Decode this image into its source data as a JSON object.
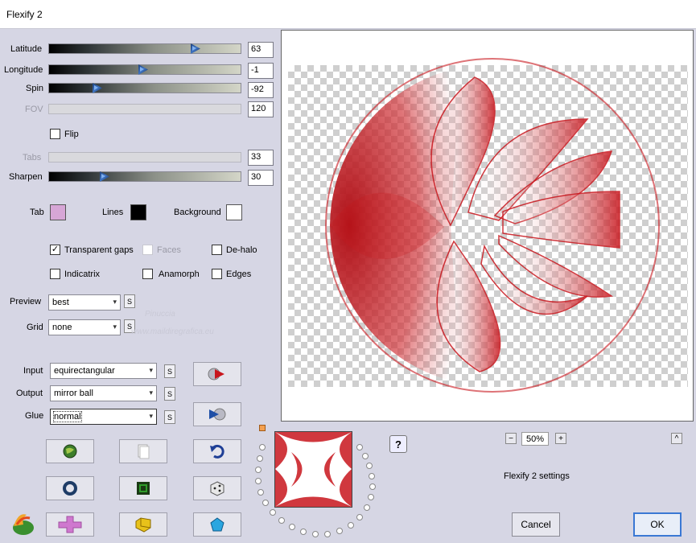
{
  "window": {
    "title": "Flexify 2"
  },
  "sliders": [
    {
      "label": "Latitude",
      "value": "63",
      "fraction": 0.78,
      "disabled": false
    },
    {
      "label": "Longitude",
      "value": "-1",
      "fraction": 0.49,
      "disabled": false
    },
    {
      "label": "Spin",
      "value": "-92",
      "fraction": 0.24,
      "disabled": false
    },
    {
      "label": "FOV",
      "value": "120",
      "fraction": null,
      "disabled": true
    },
    {
      "label": "Tabs",
      "value": "33",
      "fraction": null,
      "disabled": true
    },
    {
      "label": "Sharpen",
      "value": "30",
      "fraction": 0.28,
      "disabled": false
    }
  ],
  "flip": {
    "label": "Flip",
    "checked": false
  },
  "colors": {
    "tab": {
      "label": "Tab",
      "color": "#d7a6d6"
    },
    "lines": {
      "label": "Lines",
      "color": "#000000"
    },
    "background": {
      "label": "Background",
      "color": "#ffffff"
    }
  },
  "options": {
    "transparent_gaps": {
      "label": "Transparent gaps",
      "checked": true
    },
    "faces": {
      "label": "Faces",
      "checked": false,
      "disabled": true
    },
    "de_halo": {
      "label": "De-halo",
      "checked": false
    },
    "indicatrix": {
      "label": "Indicatrix",
      "checked": false
    },
    "anamorph": {
      "label": "Anamorph",
      "checked": false
    },
    "edges": {
      "label": "Edges",
      "checked": false
    }
  },
  "preview_select": {
    "label": "Preview",
    "value": "best"
  },
  "grid_select": {
    "label": "Grid",
    "value": "none"
  },
  "s_label": "S",
  "watermark": {
    "name": "Pinuccia",
    "url": "www.maildiregrafica.eu"
  },
  "projection": {
    "input": {
      "label": "Input",
      "value": "equirectangular"
    },
    "output": {
      "label": "Output",
      "value": "mirror ball"
    },
    "glue": {
      "label": "Glue",
      "value": "normal"
    }
  },
  "zoom": {
    "minus": "−",
    "value": "50%",
    "plus": "+",
    "caret": "^"
  },
  "help_label": "?",
  "settings_label": "Flexify 2 settings",
  "cancel_label": "Cancel",
  "ok_label": "OK",
  "accent_red": "#c8161d"
}
